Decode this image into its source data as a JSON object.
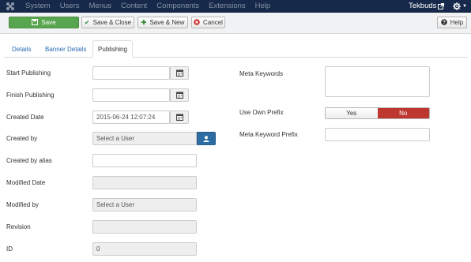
{
  "topbar": {
    "menu": [
      "System",
      "Users",
      "Menus",
      "Content",
      "Components",
      "Extensions",
      "Help"
    ],
    "user": "Tekbuds",
    "logo_icon": "joomla-logo-icon",
    "external_icon": "external-link-icon",
    "settings_icon": "gear-icon"
  },
  "toolbar": {
    "save": "Save",
    "save_close": "Save & Close",
    "save_new": "Save & New",
    "cancel": "Cancel",
    "help": "Help"
  },
  "tabs": [
    "Details",
    "Banner Details",
    "Publishing"
  ],
  "active_tab": "Publishing",
  "form_left": {
    "start_publishing": {
      "label": "Start Publishing",
      "value": ""
    },
    "finish_publishing": {
      "label": "Finish Publishing",
      "value": ""
    },
    "created_date": {
      "label": "Created Date",
      "value": "2015-06-24 12:07:24"
    },
    "created_by": {
      "label": "Created by",
      "value": "Select a User"
    },
    "created_by_alias": {
      "label": "Created by alias",
      "value": ""
    },
    "modified_date": {
      "label": "Modified Date",
      "value": ""
    },
    "modified_by": {
      "label": "Modified by",
      "value": "Select a User"
    },
    "revision": {
      "label": "Revision",
      "value": ""
    },
    "id": {
      "label": "ID",
      "value": "0"
    }
  },
  "form_right": {
    "meta_keywords": {
      "label": "Meta Keywords",
      "value": ""
    },
    "use_own_prefix": {
      "label": "Use Own Prefix",
      "options": [
        "Yes",
        "No"
      ],
      "selected": "No"
    },
    "meta_keyword_prefix": {
      "label": "Meta Keyword Prefix",
      "value": ""
    }
  },
  "colors": {
    "topbar_bg": "#17294a",
    "save_green": "#58a54f",
    "toggle_no_red": "#bd362f",
    "user_btn_blue": "#2d6ca2",
    "tab_link": "#2a69b8"
  }
}
